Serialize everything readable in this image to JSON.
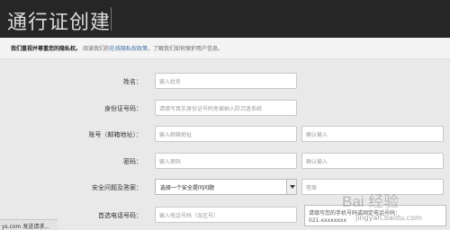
{
  "header": {
    "title": "通行证创建"
  },
  "privacy": {
    "strong": "我们重视并尊重您的隐私权。",
    "text1": "阅读我们的",
    "link": "在线隐私权政策",
    "text2": "，了解我们如何保护用户信息。"
  },
  "form": {
    "name": {
      "label": "姓名：",
      "placeholder": "输入姓名"
    },
    "id_card": {
      "label": "身份证号码：",
      "placeholder": "请填写真实身份证号码免被纳入防沉迷系统"
    },
    "account": {
      "label": "账号（邮箱地址）：",
      "placeholder": "输入邮箱地址",
      "confirm_placeholder": "确认输入"
    },
    "password": {
      "label": "密码：",
      "placeholder": "输入密码",
      "confirm_placeholder": "确认输入"
    },
    "security": {
      "label": "安全问题及答案：",
      "select_value": "选择一个安全提问问题",
      "answer_placeholder": "答案"
    },
    "phone": {
      "label": "首选电话号码：",
      "placeholder": "输入电话号码（含区号）"
    }
  },
  "tooltip": {
    "line1": "请填写您的手机号码或固定电话号码：",
    "line2": "021-xxxxxxxx"
  },
  "status_bar": {
    "text": "ys.com 发送请求..."
  },
  "watermark": {
    "brand": "Bai 经验",
    "url": "jingyan.baidu.com"
  }
}
